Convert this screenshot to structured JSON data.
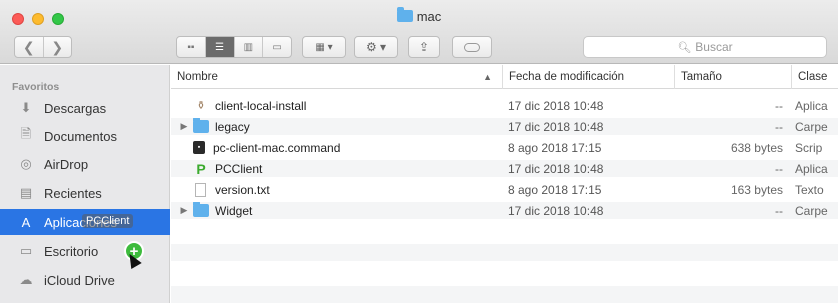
{
  "window": {
    "title": "mac"
  },
  "toolbar": {
    "back_icon": "chevron-left-icon",
    "forward_icon": "chevron-right-icon",
    "arrange_icon": "grid-arrange-icon",
    "action_icon": "gear-icon",
    "share_icon": "share-icon",
    "tag_icon": "tag-icon",
    "search_placeholder": "Buscar"
  },
  "sidebar": {
    "header": "Favoritos",
    "items": [
      {
        "label": "Descargas",
        "icon": "download-icon"
      },
      {
        "label": "Documentos",
        "icon": "documents-icon"
      },
      {
        "label": "AirDrop",
        "icon": "airdrop-icon"
      },
      {
        "label": "Recientes",
        "icon": "recents-icon"
      },
      {
        "label": "Aplicaciones",
        "icon": "applications-icon",
        "selected": true,
        "drag_label": "PCClient"
      },
      {
        "label": "Escritorio",
        "icon": "desktop-icon"
      },
      {
        "label": "iCloud Drive",
        "icon": "cloud-icon"
      }
    ]
  },
  "columns": {
    "name": "Nombre",
    "date": "Fecha de modificación",
    "size": "Tamaño",
    "kind": "Clase"
  },
  "files": [
    {
      "name": "client-local-install",
      "date": "17 dic 2018 10:48",
      "size": "--",
      "kind": "Aplica",
      "icon": "package-icon",
      "expandable": false
    },
    {
      "name": "legacy",
      "date": "17 dic 2018 10:48",
      "size": "--",
      "kind": "Carpe",
      "icon": "folder-icon",
      "expandable": true
    },
    {
      "name": "pc-client-mac.command",
      "date": "8 ago 2018 17:15",
      "size": "638 bytes",
      "kind": "Scrip",
      "icon": "script-icon",
      "expandable": false
    },
    {
      "name": "PCClient",
      "date": "17 dic 2018 10:48",
      "size": "--",
      "kind": "Aplica",
      "icon": "app-icon",
      "expandable": false
    },
    {
      "name": "version.txt",
      "date": "8 ago 2018 17:15",
      "size": "163 bytes",
      "kind": "Texto",
      "icon": "text-file-icon",
      "expandable": false
    },
    {
      "name": "Widget",
      "date": "17 dic 2018 10:48",
      "size": "--",
      "kind": "Carpe",
      "icon": "folder-icon",
      "expandable": true
    }
  ]
}
